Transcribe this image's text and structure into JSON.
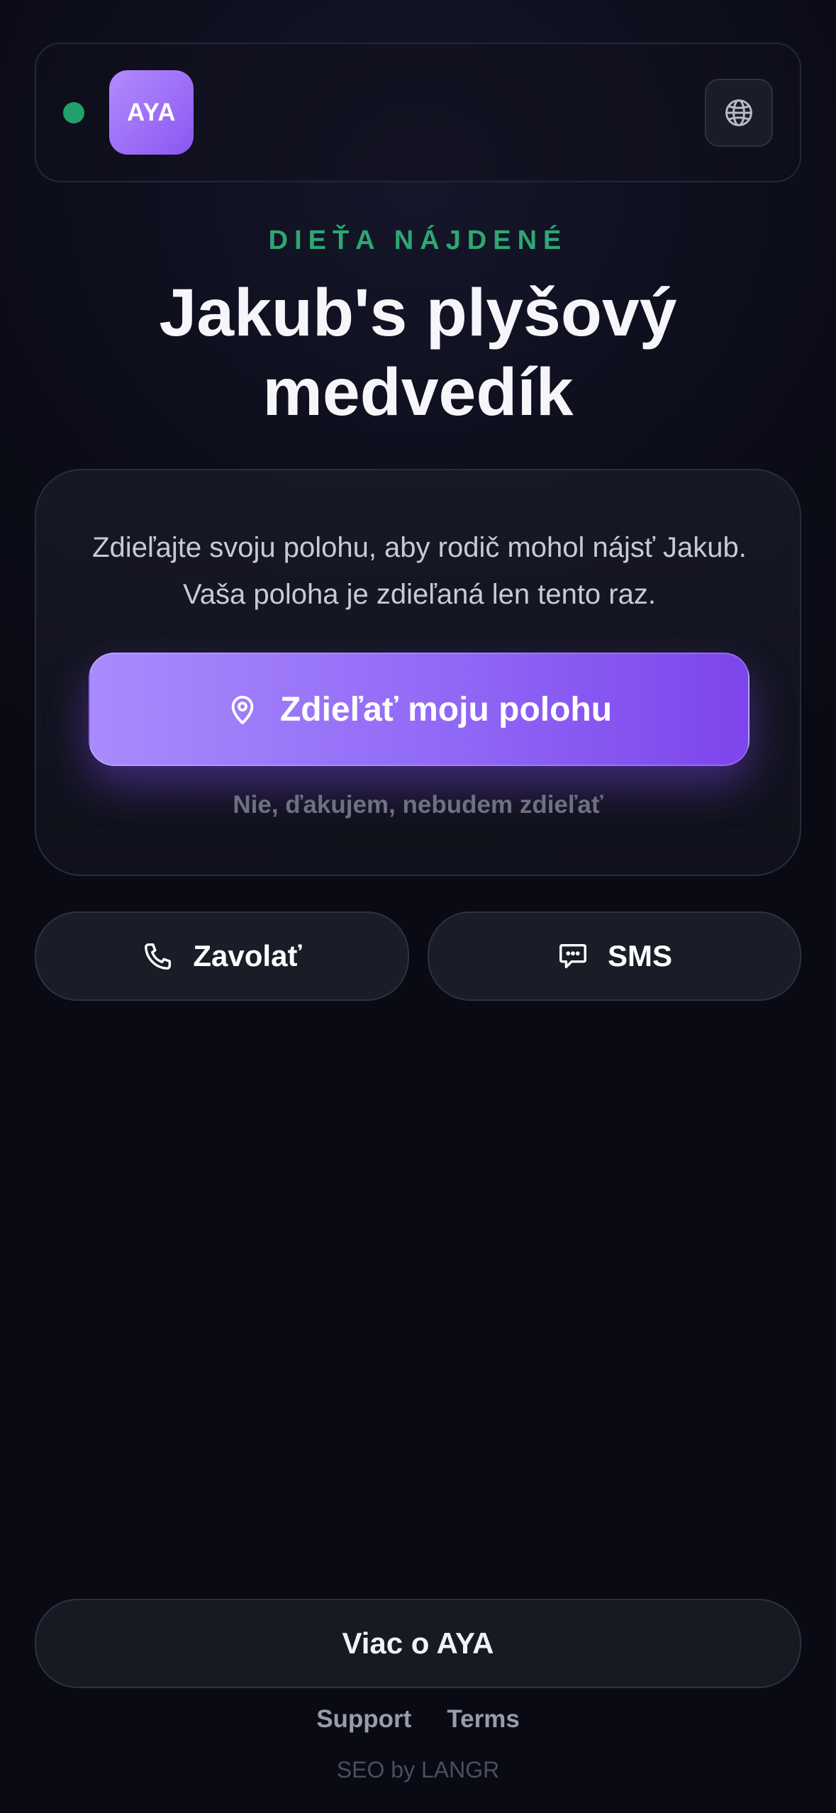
{
  "header": {
    "logo_text": "AYA",
    "status_color": "#22a06b",
    "language_icon": "globe-icon"
  },
  "hero": {
    "eyebrow": "DIEŤA NÁJDENÉ",
    "title": "Jakub's plyšový medvedík"
  },
  "share_card": {
    "description": "Zdieľajte svoju polohu, aby rodič mohol nájsť Jakub. Vaša poloha je zdieľaná len tento raz.",
    "share_label": "Zdieľať moju polohu",
    "share_icon": "location-pin-icon",
    "decline_label": "Nie, ďakujem, nebudem zdieľať"
  },
  "contact": {
    "call_label": "Zavolať",
    "call_icon": "phone-icon",
    "sms_label": "SMS",
    "sms_icon": "chat-bubble-icon"
  },
  "footer": {
    "more_label": "Viac o AYA",
    "links": [
      "Support",
      "Terms"
    ],
    "credit": "SEO by LANGR"
  },
  "colors": {
    "accent_purple": "#8b56f0",
    "accent_green": "#2ea774",
    "background": "#0b0c17"
  }
}
